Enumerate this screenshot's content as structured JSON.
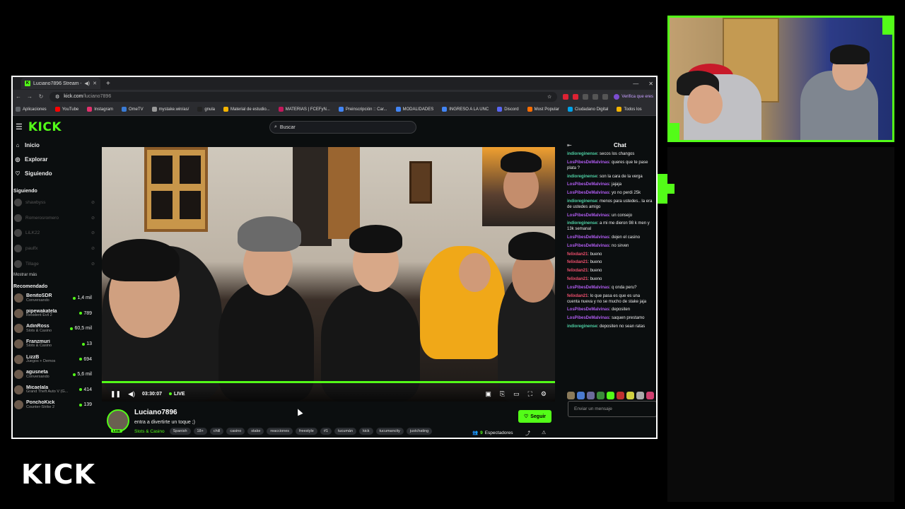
{
  "browser": {
    "tab_title": "Luciano7896 Stream - Watc",
    "url_host": "kick.com",
    "url_path": "/luciano7896",
    "profile_text": "Verifica que eres",
    "bookmarks": [
      "Aplicaciones",
      "YouTube",
      "Instagram",
      "OmeTV",
      "mystake.win/as/",
      "gnula",
      "Material de estudio...",
      "MATERIAS | FCEFyN...",
      "Preinscripción :: Car...",
      "MODALIDADES",
      "INGRESO A LA UNC",
      "Discord",
      "Most Popular",
      "Ciudadano Digital",
      "Todos los"
    ],
    "bookmark_colors": [
      "#5f6368",
      "#ff0000",
      "#e1306c",
      "#3a7bd5",
      "#999999",
      "#222222",
      "#f4b400",
      "#c2185b",
      "#4285f4",
      "#4285f4",
      "#4285f4",
      "#5865f2",
      "#ff6d00",
      "#00a2e8",
      "#f4b400"
    ]
  },
  "kick": {
    "brand_color": "#53fc18",
    "logo": "KICK",
    "search_placeholder": "Buscar",
    "nav": [
      {
        "label": "Inicio",
        "icon": "home-icon"
      },
      {
        "label": "Explorar",
        "icon": "compass-icon"
      },
      {
        "label": "Siguiendo",
        "icon": "heart-icon"
      }
    ],
    "following_title": "Siguiendo",
    "following": [
      "shawbyss",
      "Romerosromero",
      "LiLK22",
      "paulfx",
      "Tillage"
    ],
    "show_more": "Mostrar más",
    "recommended_title": "Recomendado",
    "recommended": [
      {
        "name": "BenitoSDR",
        "category": "Conversando",
        "viewers": "1,4 mil"
      },
      {
        "name": "pipewakatela",
        "category": "Resident Evil 2",
        "viewers": "789"
      },
      {
        "name": "AdinRoss",
        "category": "Slots & Casino",
        "viewers": "60,5 mil"
      },
      {
        "name": "Franzmuri",
        "category": "Slots & Casino",
        "viewers": "13"
      },
      {
        "name": "LizzB",
        "category": "Juegos + Demos",
        "viewers": "694"
      },
      {
        "name": "agusneta",
        "category": "Conversando",
        "viewers": "5,6 mil"
      },
      {
        "name": "Micaelala",
        "category": "Grand Theft Auto V (G...",
        "viewers": "414"
      },
      {
        "name": "PonchoKick",
        "category": "Counter-Strike 2",
        "viewers": "139"
      }
    ]
  },
  "player": {
    "time": "03:30:07",
    "live_label": "LIVE"
  },
  "stream": {
    "streamer": "Luciano7896",
    "title": "entra a divertirte un toque ;)",
    "category": "Slots & Casino",
    "tags": [
      "Spanish",
      "18+",
      "chill",
      "casino",
      "stake",
      "reacciones",
      "freestyle",
      "#1",
      "tucumán",
      "kick",
      "tucumancity",
      "justchating"
    ],
    "live_badge": "LIVE",
    "follow_label": "Seguir",
    "viewer_count": "9",
    "viewer_label": "Espectadores"
  },
  "chat": {
    "title": "Chat",
    "input_placeholder": "Enviar un mensaje",
    "messages": [
      {
        "user": "indioreginense",
        "color": "#4fd1a5",
        "text": "secos los changos"
      },
      {
        "user": "LosPibesDeMalvinas",
        "color": "#b05cf0",
        "text": "queres que te pase plata ?"
      },
      {
        "user": "indioreginense",
        "color": "#4fd1a5",
        "text": "son la cara de la verga"
      },
      {
        "user": "LosPibesDeMalvinas",
        "color": "#b05cf0",
        "text": "jajaja"
      },
      {
        "user": "LosPibesDeMalvinas",
        "color": "#b05cf0",
        "text": "yo no perdi 25k"
      },
      {
        "user": "indioreginense",
        "color": "#4fd1a5",
        "text": "menos para ustedes.. la era de ustedes amigo"
      },
      {
        "user": "LosPibesDeMalvinas",
        "color": "#b05cf0",
        "text": "un consejo"
      },
      {
        "user": "indioreginense",
        "color": "#4fd1a5",
        "text": "a mi me dieron 98 k men y 13k semanal"
      },
      {
        "user": "LosPibesDeMalvinas",
        "color": "#b05cf0",
        "text": "dejen el casino"
      },
      {
        "user": "LosPibesDeMalvinas",
        "color": "#b05cf0",
        "text": "no sirven"
      },
      {
        "user": "felixdan21",
        "color": "#f0506e",
        "text": "bueno"
      },
      {
        "user": "felixdan21",
        "color": "#f0506e",
        "text": "bueno"
      },
      {
        "user": "felixdan21",
        "color": "#f0506e",
        "text": "bueno"
      },
      {
        "user": "felixdan21",
        "color": "#f0506e",
        "text": "bueno"
      },
      {
        "user": "LosPibesDeMalvinas",
        "color": "#b05cf0",
        "text": "q onda peru?"
      },
      {
        "user": "felixdan21",
        "color": "#f0506e",
        "text": "lo que pasa es que es una cuenta nueva y no se mucho de stake jaja"
      },
      {
        "user": "LosPibesDeMalvinas",
        "color": "#b05cf0",
        "text": "depositen"
      },
      {
        "user": "LosPibesDeMalvinas",
        "color": "#b05cf0",
        "text": "saquen prestamo"
      },
      {
        "user": "indioreginense",
        "color": "#4fd1a5",
        "text": "depositen no sean ratas"
      }
    ],
    "emote_colors": [
      "#8a7a5a",
      "#4a7ad0",
      "#6a6a9a",
      "#3a8a3a",
      "#53fc18",
      "#c03030",
      "#d0d040",
      "#aaaaaa",
      "#d04070",
      "#30a050",
      "#2a7fd0"
    ]
  },
  "overlay": {
    "watermark": "KICK"
  }
}
